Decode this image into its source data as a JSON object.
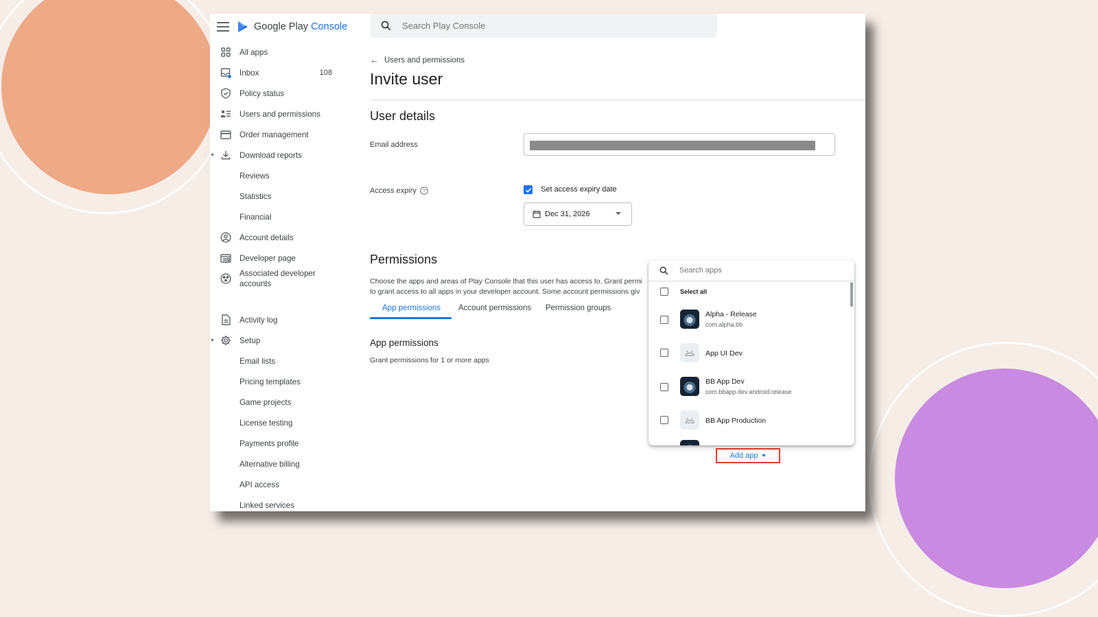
{
  "brand": {
    "name": "Google Play",
    "accent": "Console"
  },
  "search": {
    "placeholder": "Search Play Console"
  },
  "sidebar": {
    "items": [
      {
        "label": "All apps",
        "icon": "grid-icon"
      },
      {
        "label": "Inbox",
        "icon": "inbox-icon",
        "count": "108"
      },
      {
        "label": "Policy status",
        "icon": "shield-icon"
      },
      {
        "label": "Users and permissions",
        "icon": "users-list-icon"
      },
      {
        "label": "Order management",
        "icon": "credit-card-icon"
      },
      {
        "label": "Download reports",
        "icon": "download-icon",
        "expanded": true
      },
      {
        "label": "Reviews"
      },
      {
        "label": "Statistics"
      },
      {
        "label": "Financial"
      },
      {
        "label": "Account details",
        "icon": "account-circle-icon"
      },
      {
        "label": "Developer page",
        "icon": "web-page-icon"
      },
      {
        "label": "Associated developer accounts",
        "icon": "linked-accounts-icon"
      },
      {
        "label": "Activity log",
        "icon": "document-icon"
      },
      {
        "label": "Setup",
        "icon": "gear-icon",
        "expanded": true
      },
      {
        "label": "Email lists"
      },
      {
        "label": "Pricing templates"
      },
      {
        "label": "Game projects"
      },
      {
        "label": "License testing"
      },
      {
        "label": "Payments profile"
      },
      {
        "label": "Alternative billing"
      },
      {
        "label": "API access"
      },
      {
        "label": "Linked services"
      }
    ]
  },
  "header": {
    "back_label": "Users and permissions",
    "title": "Invite user"
  },
  "user_details": {
    "title": "User details",
    "email_label": "Email address",
    "expiry_label": "Access expiry",
    "expiry_checkbox_label": "Set access expiry date",
    "expiry_checked": true,
    "expiry_date": "Dec 31, 2026"
  },
  "permissions": {
    "title": "Permissions",
    "desc_line1": "Choose the apps and areas of Play Console that this user has access to. Grant permi",
    "desc_line2": "to grant access to all apps in your developer account. Some account permissions giv",
    "tabs": [
      {
        "label": "App permissions",
        "active": true
      },
      {
        "label": "Account permissions"
      },
      {
        "label": "Permission groups"
      }
    ],
    "app_permissions_title": "App permissions",
    "app_permissions_desc": "Grant permissions for 1 or more apps",
    "add_app_label": "Add app"
  },
  "app_picker": {
    "search_placeholder": "Search apps",
    "select_all_label": "Select all",
    "apps": [
      {
        "name": "Alpha - Release",
        "package": "com.alpha.bb",
        "icon": "app-icon-dark"
      },
      {
        "name": "App UI Dev",
        "package": "",
        "icon": "android-placeholder-icon"
      },
      {
        "name": "BB App Dev",
        "package": "com.bbapp.dev.android.release",
        "icon": "app-icon-dark"
      },
      {
        "name": "BB App Production",
        "package": "",
        "icon": "android-placeholder-icon"
      }
    ]
  },
  "colors": {
    "background": "#f6ede7",
    "accent": "#1a73e8",
    "highlight_border": "#e0402a",
    "deco_orange": "#eea987",
    "deco_purple": "#c98ae1"
  }
}
